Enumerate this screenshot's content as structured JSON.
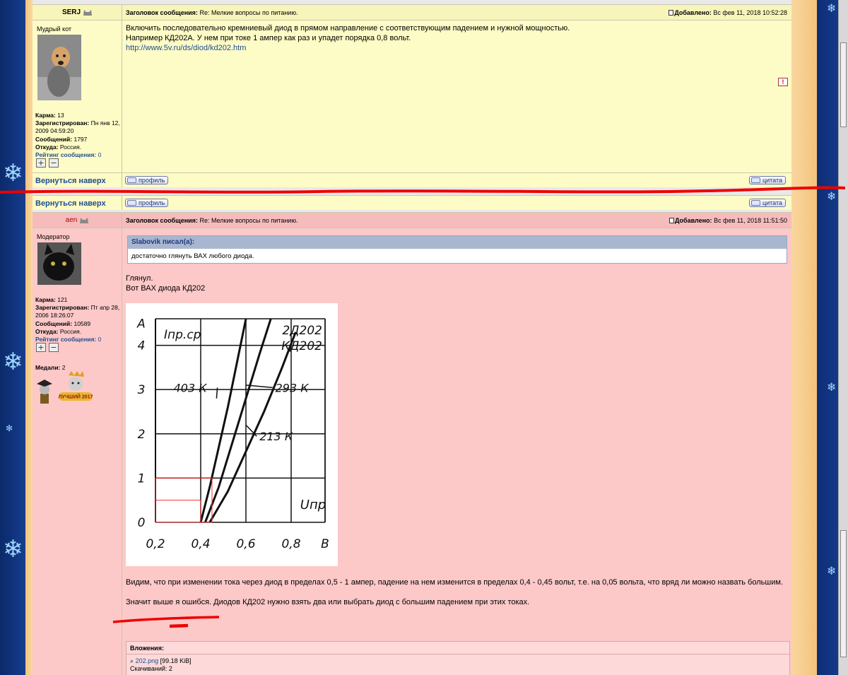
{
  "post1": {
    "author": "SERJ",
    "rank": "Мудрый кот",
    "subject_label": "Заголовок сообщения:",
    "subject": "Re: Мелкие вопросы по питанию.",
    "added_label": "Добавлено:",
    "added": "Вс фев 11, 2018 10:52:28",
    "karma_label": "Карма:",
    "karma": "13",
    "registered_label": "Зарегистрирован:",
    "registered": "Пн янв 12, 2009 04:59:20",
    "posts_label": "Сообщений:",
    "posts": "1797",
    "from_label": "Откуда:",
    "from": "Россия.",
    "rating_label": "Рейтинг сообщения:",
    "rating": "0",
    "line1": "Включить последовательно кремниевый диод в прямом направление с соответствующим падением и нужной мощностью.",
    "line2": "Например КД202А. У нем при токе 1 ампер как раз и упадет порядка 0,8 вольт.",
    "link": "http://www.5v.ru/ds/diod/kd202.htm"
  },
  "footer": {
    "back_to_top": "Вернуться наверх",
    "profile": "профиль",
    "quote": "цитата"
  },
  "post2": {
    "author": "aen",
    "rank": "Модератор",
    "subject_label": "Заголовок сообщения:",
    "subject": "Re: Мелкие вопросы по питанию.",
    "added_label": "Добавлено:",
    "added": "Вс фев 11, 2018 11:51:50",
    "karma_label": "Карма:",
    "karma": "121",
    "registered_label": "Зарегистрирован:",
    "registered": "Пт апр 28, 2006 18:26:07",
    "posts_label": "Сообщений:",
    "posts": "10589",
    "from_label": "Откуда:",
    "from": "Россия.",
    "rating_label": "Рейтинг сообщения:",
    "rating": "0",
    "medals_label": "Медали:",
    "medals": "2",
    "medal_text": "ЛУЧШИЙ 2017",
    "quote_author": "Slabovik писал(а):",
    "quote_text": "достаточно глянуть ВАХ любого диода.",
    "text1": "Глянул.",
    "text2": "Вот ВАХ диода КД202",
    "text3": "Видим, что при изменении тока через диод в пределах 0,5 - 1 ампер, падение на нем изменится в пределах 0,4 - 0,45 вольт, т.е. на 0,05 вольта, что вряд ли можно назвать большим.",
    "text4": "Значит выше я ошибся. Диодов КД202 нужно взять два или выбрать диод с большим падением при этих токах.",
    "attach_label": "Вложения:",
    "attach_file": "202.png",
    "attach_size": "[99.18 KiB]",
    "attach_downloads": "Скачиваний: 2"
  },
  "chart_data": {
    "type": "line",
    "title": "2Д202 КД202",
    "ylabel": "Iпр.ср",
    "yunit": "A",
    "xlabel": "Uпр",
    "xunit": "В",
    "xlim": [
      0.2,
      0.95
    ],
    "ylim": [
      0,
      4.6
    ],
    "x_ticks": [
      "0,2",
      "0,4",
      "0,6",
      "0,8",
      "В"
    ],
    "y_ticks": [
      "0",
      "1",
      "2",
      "3",
      "4",
      "A"
    ],
    "series": [
      {
        "name": "403 К",
        "x": [
          0.4,
          0.44,
          0.48,
          0.52,
          0.56,
          0.6
        ],
        "y": [
          0,
          0.8,
          1.7,
          2.6,
          3.6,
          4.6
        ]
      },
      {
        "name": "293 К",
        "x": [
          0.42,
          0.48,
          0.54,
          0.6,
          0.66,
          0.71
        ],
        "y": [
          0,
          0.8,
          1.8,
          2.8,
          3.8,
          4.6
        ]
      },
      {
        "name": "213 К",
        "x": [
          0.44,
          0.52,
          0.6,
          0.68,
          0.76,
          0.82
        ],
        "y": [
          0,
          0.7,
          1.6,
          2.5,
          3.5,
          4.3
        ]
      }
    ],
    "grid": true
  }
}
